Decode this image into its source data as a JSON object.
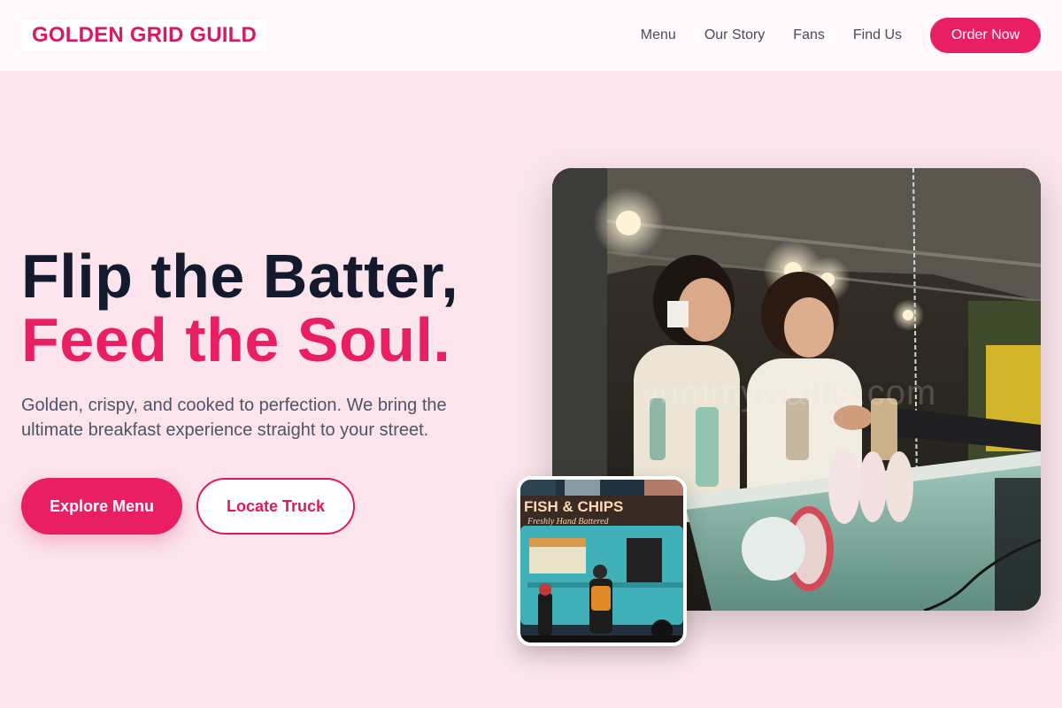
{
  "header": {
    "logo": "GOLDEN GRID GUILD",
    "nav": [
      "Menu",
      "Our Story",
      "Fans",
      "Find Us"
    ],
    "cta": "Order Now"
  },
  "hero": {
    "title_line1": "Flip the Batter,",
    "title_line2": "Feed the Soul.",
    "description": "Golden, crispy, and cooked to perfection. We bring the ultimate breakfast experience straight to your street.",
    "primary_button": "Explore Menu",
    "secondary_button": "Locate Truck"
  },
  "images": {
    "main_watermark": "yummywaffle.com",
    "truck_sign": "FISH & CHIPS",
    "truck_subsign": "Freshly Hand Battered"
  },
  "colors": {
    "accent": "#e91e63",
    "background": "#fbe4ec",
    "heading": "#141a2e"
  }
}
